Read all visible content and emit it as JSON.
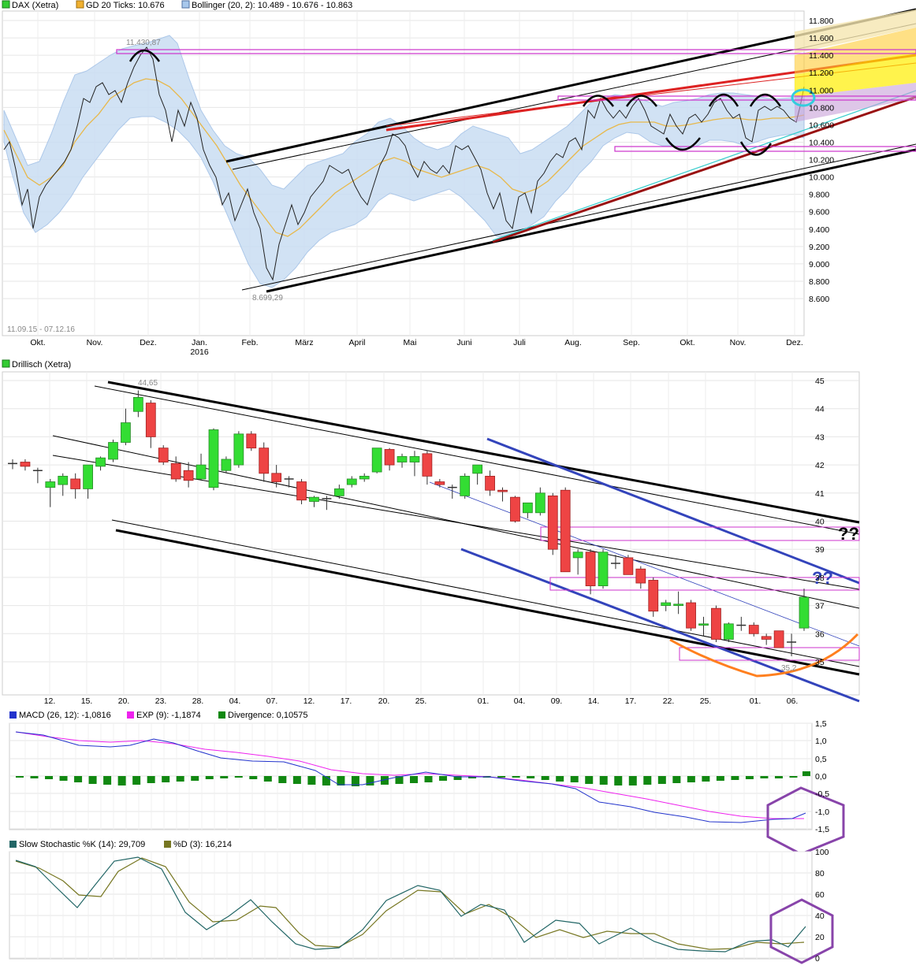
{
  "colors": {
    "up": "#33dd33",
    "down": "#ee4444",
    "upStroke": "#2a8a2a",
    "downStroke": "#a02020",
    "bollFill": "#c9ddf3",
    "bollLine": "#9fbfe6",
    "ma": "#e8b84a",
    "magenta": "#cc33cc",
    "red": "#dd2222",
    "darkred": "#991111",
    "blue": "#3344bb",
    "cyan": "#33cccc",
    "orange": "#ff7f1e",
    "purple": "#8844aa",
    "macd": "#2233cc",
    "signal": "#ee22ee",
    "diverg": "#118811",
    "stochK": "#226666",
    "stochD": "#777722",
    "yellow": "#ffee00",
    "gold": "#ffcc33",
    "lightgold": "#f5e6b0"
  },
  "panel1": {
    "legend": [
      {
        "label": "DAX (Xetra)",
        "color": "#33cc33"
      },
      {
        "label": "GD 20 Ticks: 10.676",
        "color": "#f0b030"
      },
      {
        "label": "Bollinger (20, 2): 10.489 - 10.676 - 10.863",
        "color": "#a8c8ec"
      }
    ],
    "yticks": [
      "11.800",
      "11.600",
      "11.400",
      "11.200",
      "11.000",
      "10.800",
      "10.600",
      "10.400",
      "10.200",
      "10.000",
      "9.800",
      "9.600",
      "9.400",
      "9.200",
      "9.000",
      "8.800",
      "8.600"
    ],
    "months": [
      "Okt.",
      "Nov.",
      "Dez.",
      "Jan.",
      "Feb.",
      "März",
      "April",
      "Mai",
      "Juni",
      "Juli",
      "Aug.",
      "Sep.",
      "Okt.",
      "Nov.",
      "Dez."
    ],
    "year": "2016",
    "range": "11.09.15 - 07.12.16",
    "high_label": "11.430,87",
    "low_label": "8.699,29"
  },
  "panel2": {
    "legend": [
      {
        "label": "Drillisch (Xetra)",
        "color": "#33cc33"
      }
    ],
    "yticks": [
      "45",
      "44",
      "43",
      "42",
      "41",
      "40",
      "39",
      "38",
      "37",
      "36",
      "35"
    ],
    "xticks": [
      "12.",
      "15.",
      "20.",
      "23.",
      "28.",
      "04.",
      "07.",
      "12.",
      "17.",
      "20.",
      "25.",
      "01.",
      "04.",
      "09.",
      "14.",
      "17.",
      "22.",
      "25.",
      "01.",
      "06."
    ],
    "high_label": "44,65",
    "low_label": "35,2",
    "question_marks": "??",
    "chart_data": {
      "type": "candlestick",
      "title": "Drillisch (Xetra)",
      "ylim": [
        34.6,
        45.2
      ],
      "candles": [
        {
          "o": 42.05,
          "h": 42.2,
          "l": 41.85,
          "c": 42.05
        },
        {
          "o": 42.1,
          "h": 42.2,
          "l": 41.8,
          "c": 41.95
        },
        {
          "o": 41.8,
          "h": 41.9,
          "l": 41.35,
          "c": 41.8
        },
        {
          "o": 41.2,
          "h": 41.5,
          "l": 40.5,
          "c": 41.4
        },
        {
          "o": 41.3,
          "h": 41.7,
          "l": 40.9,
          "c": 41.6
        },
        {
          "o": 41.5,
          "h": 41.7,
          "l": 40.8,
          "c": 41.15
        },
        {
          "o": 41.15,
          "h": 42.0,
          "l": 40.8,
          "c": 42.0
        },
        {
          "o": 41.95,
          "h": 42.3,
          "l": 41.8,
          "c": 42.25
        },
        {
          "o": 42.2,
          "h": 42.9,
          "l": 42.1,
          "c": 42.8
        },
        {
          "o": 42.8,
          "h": 44.0,
          "l": 42.7,
          "c": 43.5
        },
        {
          "o": 43.9,
          "h": 44.65,
          "l": 43.7,
          "c": 44.4
        },
        {
          "o": 44.2,
          "h": 44.3,
          "l": 42.6,
          "c": 43.0
        },
        {
          "o": 42.6,
          "h": 42.7,
          "l": 42.0,
          "c": 42.1
        },
        {
          "o": 42.05,
          "h": 42.3,
          "l": 41.4,
          "c": 41.5
        },
        {
          "o": 41.8,
          "h": 42.1,
          "l": 41.2,
          "c": 41.45
        },
        {
          "o": 41.5,
          "h": 42.4,
          "l": 41.45,
          "c": 42.0
        },
        {
          "o": 41.2,
          "h": 43.3,
          "l": 41.1,
          "c": 43.25
        },
        {
          "o": 41.8,
          "h": 42.3,
          "l": 41.7,
          "c": 42.2
        },
        {
          "o": 42.0,
          "h": 43.2,
          "l": 41.9,
          "c": 43.1
        },
        {
          "o": 43.1,
          "h": 43.2,
          "l": 42.5,
          "c": 42.6
        },
        {
          "o": 42.6,
          "h": 42.8,
          "l": 41.4,
          "c": 41.7
        },
        {
          "o": 41.7,
          "h": 42.0,
          "l": 41.2,
          "c": 41.4
        },
        {
          "o": 41.5,
          "h": 41.6,
          "l": 41.2,
          "c": 41.5
        },
        {
          "o": 41.4,
          "h": 41.5,
          "l": 40.6,
          "c": 40.75
        },
        {
          "o": 40.7,
          "h": 40.9,
          "l": 40.5,
          "c": 40.85
        },
        {
          "o": 40.8,
          "h": 40.9,
          "l": 40.4,
          "c": 40.8
        },
        {
          "o": 40.9,
          "h": 41.3,
          "l": 40.8,
          "c": 41.15
        },
        {
          "o": 41.3,
          "h": 41.6,
          "l": 41.2,
          "c": 41.5
        },
        {
          "o": 41.5,
          "h": 41.7,
          "l": 41.4,
          "c": 41.6
        },
        {
          "o": 41.75,
          "h": 42.6,
          "l": 41.7,
          "c": 42.6
        },
        {
          "o": 42.55,
          "h": 42.6,
          "l": 41.8,
          "c": 42.0
        },
        {
          "o": 42.1,
          "h": 42.4,
          "l": 41.9,
          "c": 42.3
        },
        {
          "o": 42.1,
          "h": 42.5,
          "l": 41.6,
          "c": 42.3
        },
        {
          "o": 42.4,
          "h": 42.5,
          "l": 41.3,
          "c": 41.6
        },
        {
          "o": 41.4,
          "h": 41.5,
          "l": 41.2,
          "c": 41.3
        },
        {
          "o": 41.2,
          "h": 41.3,
          "l": 40.8,
          "c": 41.2
        },
        {
          "o": 40.9,
          "h": 41.7,
          "l": 40.8,
          "c": 41.6
        },
        {
          "o": 41.7,
          "h": 42.0,
          "l": 41.3,
          "c": 42.0
        },
        {
          "o": 41.6,
          "h": 41.8,
          "l": 40.9,
          "c": 41.1
        },
        {
          "o": 41.1,
          "h": 41.2,
          "l": 40.7,
          "c": 41.05
        },
        {
          "o": 40.85,
          "h": 40.9,
          "l": 39.95,
          "c": 40.0
        },
        {
          "o": 40.3,
          "h": 40.6,
          "l": 40.1,
          "c": 40.65
        },
        {
          "o": 40.3,
          "h": 41.2,
          "l": 40.2,
          "c": 41.0
        },
        {
          "o": 40.9,
          "h": 41.0,
          "l": 38.8,
          "c": 39.0
        },
        {
          "o": 41.1,
          "h": 41.2,
          "l": 38.2,
          "c": 38.2
        },
        {
          "o": 38.7,
          "h": 39.0,
          "l": 38.1,
          "c": 38.9
        },
        {
          "o": 38.9,
          "h": 39.0,
          "l": 37.4,
          "c": 37.7
        },
        {
          "o": 37.7,
          "h": 39.0,
          "l": 37.6,
          "c": 38.9
        },
        {
          "o": 38.5,
          "h": 38.8,
          "l": 38.3,
          "c": 38.5
        },
        {
          "o": 38.7,
          "h": 38.8,
          "l": 38.1,
          "c": 38.1
        },
        {
          "o": 38.3,
          "h": 38.4,
          "l": 37.6,
          "c": 37.8
        },
        {
          "o": 37.9,
          "h": 38.0,
          "l": 36.6,
          "c": 36.8
        },
        {
          "o": 37.0,
          "h": 37.2,
          "l": 36.8,
          "c": 37.1
        },
        {
          "o": 37.0,
          "h": 37.5,
          "l": 36.7,
          "c": 37.05
        },
        {
          "o": 37.1,
          "h": 37.2,
          "l": 36.1,
          "c": 36.2
        },
        {
          "o": 36.3,
          "h": 36.6,
          "l": 35.9,
          "c": 36.35
        },
        {
          "o": 36.9,
          "h": 37.0,
          "l": 35.7,
          "c": 35.8
        },
        {
          "o": 35.8,
          "h": 36.4,
          "l": 35.7,
          "c": 36.35
        },
        {
          "o": 36.3,
          "h": 36.6,
          "l": 36.1,
          "c": 36.3
        },
        {
          "o": 36.3,
          "h": 36.4,
          "l": 35.9,
          "c": 36.0
        },
        {
          "o": 35.9,
          "h": 36.0,
          "l": 35.6,
          "c": 35.8
        },
        {
          "o": 36.1,
          "h": 36.1,
          "l": 35.5,
          "c": 35.5
        },
        {
          "o": 35.7,
          "h": 36.0,
          "l": 35.2,
          "c": 35.7
        },
        {
          "o": 36.2,
          "h": 37.6,
          "l": 36.1,
          "c": 37.3
        }
      ]
    }
  },
  "panel3": {
    "legend": [
      {
        "label": "MACD (26, 12): -1,0816",
        "color": "#2233cc"
      },
      {
        "label": "EXP (9): -1,1874",
        "color": "#ee22ee"
      },
      {
        "label": "Divergence: 0,10575",
        "color": "#118811"
      }
    ],
    "yticks": [
      "1,5",
      "1,0",
      "0,5",
      "0,0",
      "-0,5",
      "-1,0",
      "-1,5"
    ]
  },
  "panel4": {
    "legend": [
      {
        "label": "Slow Stochastic %K (14): 29,709",
        "color": "#226666"
      },
      {
        "label": "%D (3): 16,214",
        "color": "#777722"
      }
    ],
    "yticks": [
      "100",
      "80",
      "60",
      "40",
      "20",
      "0"
    ]
  }
}
